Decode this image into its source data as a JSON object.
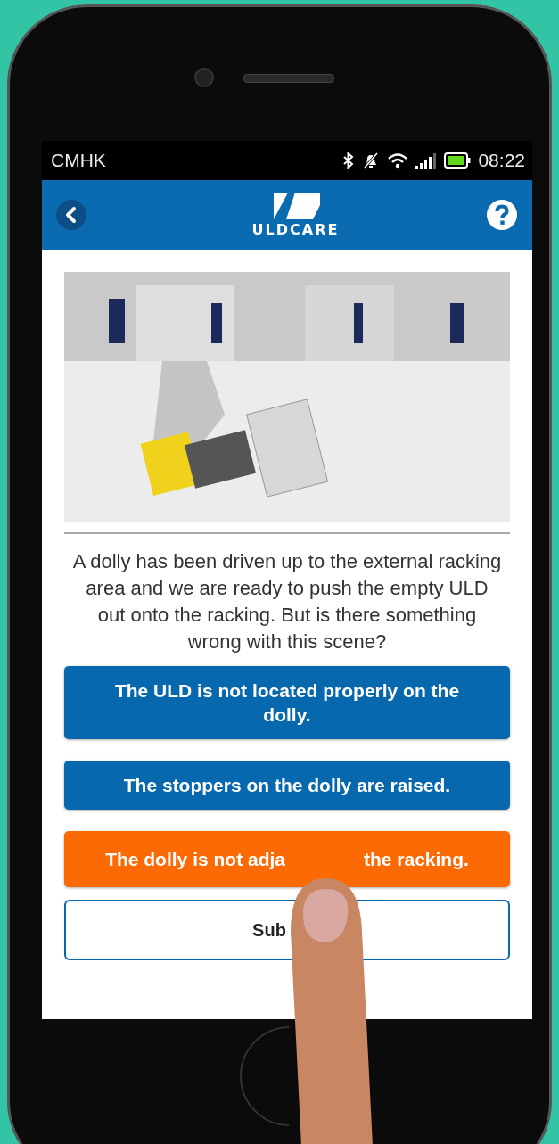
{
  "status_bar": {
    "carrier": "CMHK",
    "time": "08:22"
  },
  "app_bar": {
    "logo_text": "ULDCARE"
  },
  "question": "A dolly has been driven up to the external racking area and we are ready to push the empty ULD out onto the racking. But is there something wrong with this scene?",
  "options": [
    {
      "texts": [
        "The ULD is not located properly on the dolly."
      ],
      "selected": false
    },
    {
      "texts": [
        "The stoppers on the dolly are raised."
      ],
      "selected": false
    },
    {
      "texts": [
        "The dolly is not adja",
        "the racking."
      ],
      "selected": true
    }
  ],
  "submit_button": {
    "label": "Sub"
  }
}
